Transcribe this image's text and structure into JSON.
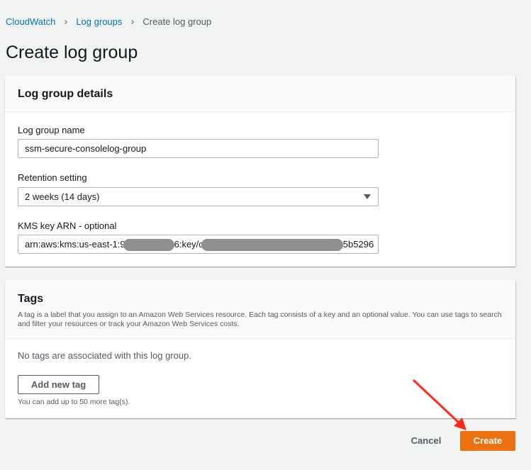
{
  "breadcrumb": [
    "CloudWatch",
    "Log groups",
    "Create log group"
  ],
  "page_title": "Create log group",
  "details": {
    "title": "Log group details",
    "name_label": "Log group name",
    "name_value": "ssm-secure-consolelog-group",
    "retention_label": "Retention setting",
    "retention_value": "2 weeks (14 days)",
    "kms_label": "KMS key ARN - optional",
    "kms_parts": [
      "arn:aws:kms:us-east-1:9",
      "6:key/c",
      "5b5296"
    ]
  },
  "tags": {
    "title": "Tags",
    "description": "A tag is a label that you assign to an Amazon Web Services resource. Each tag consists of a key and an optional value. You can use tags to search and filter your resources or track your Amazon Web Services costs.",
    "empty": "No tags are associated with this log group.",
    "add_button": "Add new tag",
    "limit": "You can add up to 50 more tag(s)."
  },
  "actions": {
    "cancel": "Cancel",
    "create": "Create"
  },
  "colors": {
    "primary": "#ec7211",
    "link": "#0073bb",
    "annotation": "#ff2a1a"
  }
}
